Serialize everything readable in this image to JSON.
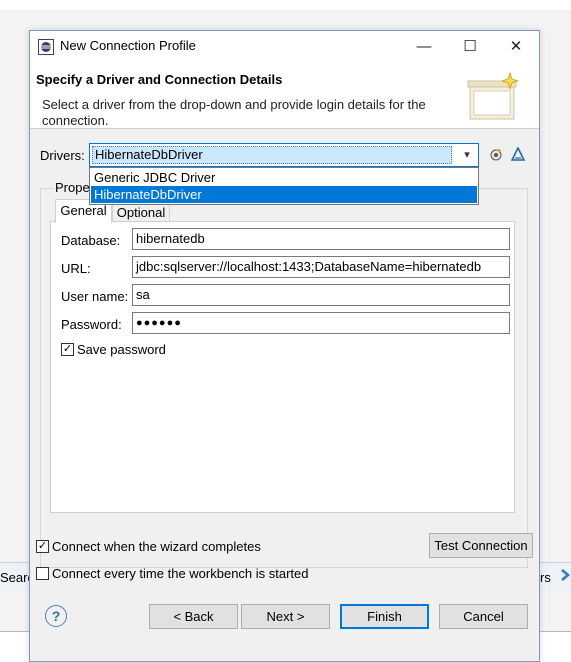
{
  "background": {
    "left_label": "Searc",
    "right_label": "rs"
  },
  "dialog": {
    "title": "New Connection Profile",
    "window_buttons": {
      "minimize": "—",
      "maximize": "☐",
      "close": "✕"
    },
    "header": {
      "title": "Specify a Driver and Connection Details",
      "description": "Select a driver from the drop-down and provide login details for the connection."
    },
    "drivers": {
      "label": "Drivers:",
      "selected": "HibernateDbDriver",
      "options": [
        "Generic JDBC Driver",
        "HibernateDbDriver"
      ],
      "highlighted_option": "HibernateDbDriver"
    },
    "properties": {
      "group_label": "Prope",
      "tabs": [
        "General",
        "Optional"
      ],
      "active_tab": "General",
      "fields": {
        "database": {
          "label": "Database:",
          "value": "hibernatedb"
        },
        "url": {
          "label": "URL:",
          "value": "jdbc:sqlserver://localhost:1433;DatabaseName=hibernatedb"
        },
        "username": {
          "label": "User name:",
          "value": "sa"
        },
        "password": {
          "label": "Password:",
          "value": "●●●●●●"
        }
      },
      "save_password": {
        "label": "Save password",
        "checked": true
      }
    },
    "connect_when_complete": {
      "label": "Connect when the wizard completes",
      "checked": true
    },
    "connect_every_time": {
      "label": "Connect every time the workbench is started",
      "checked": false
    },
    "test_connection_label": "Test Connection",
    "footer": {
      "help": "?",
      "back": "< Back",
      "next": "Next >",
      "finish": "Finish",
      "cancel": "Cancel"
    }
  },
  "colors": {
    "accent": "#0078d7",
    "dialog_bg": "#f0f0f0",
    "selection_bg": "#0078d7"
  },
  "icons": {
    "app": "eclipse-icon",
    "wizard": "database-wizard-icon",
    "new_driver": "new-driver-icon",
    "edit_driver": "edit-driver-icon",
    "help": "help-icon",
    "checkmark": "✓"
  }
}
